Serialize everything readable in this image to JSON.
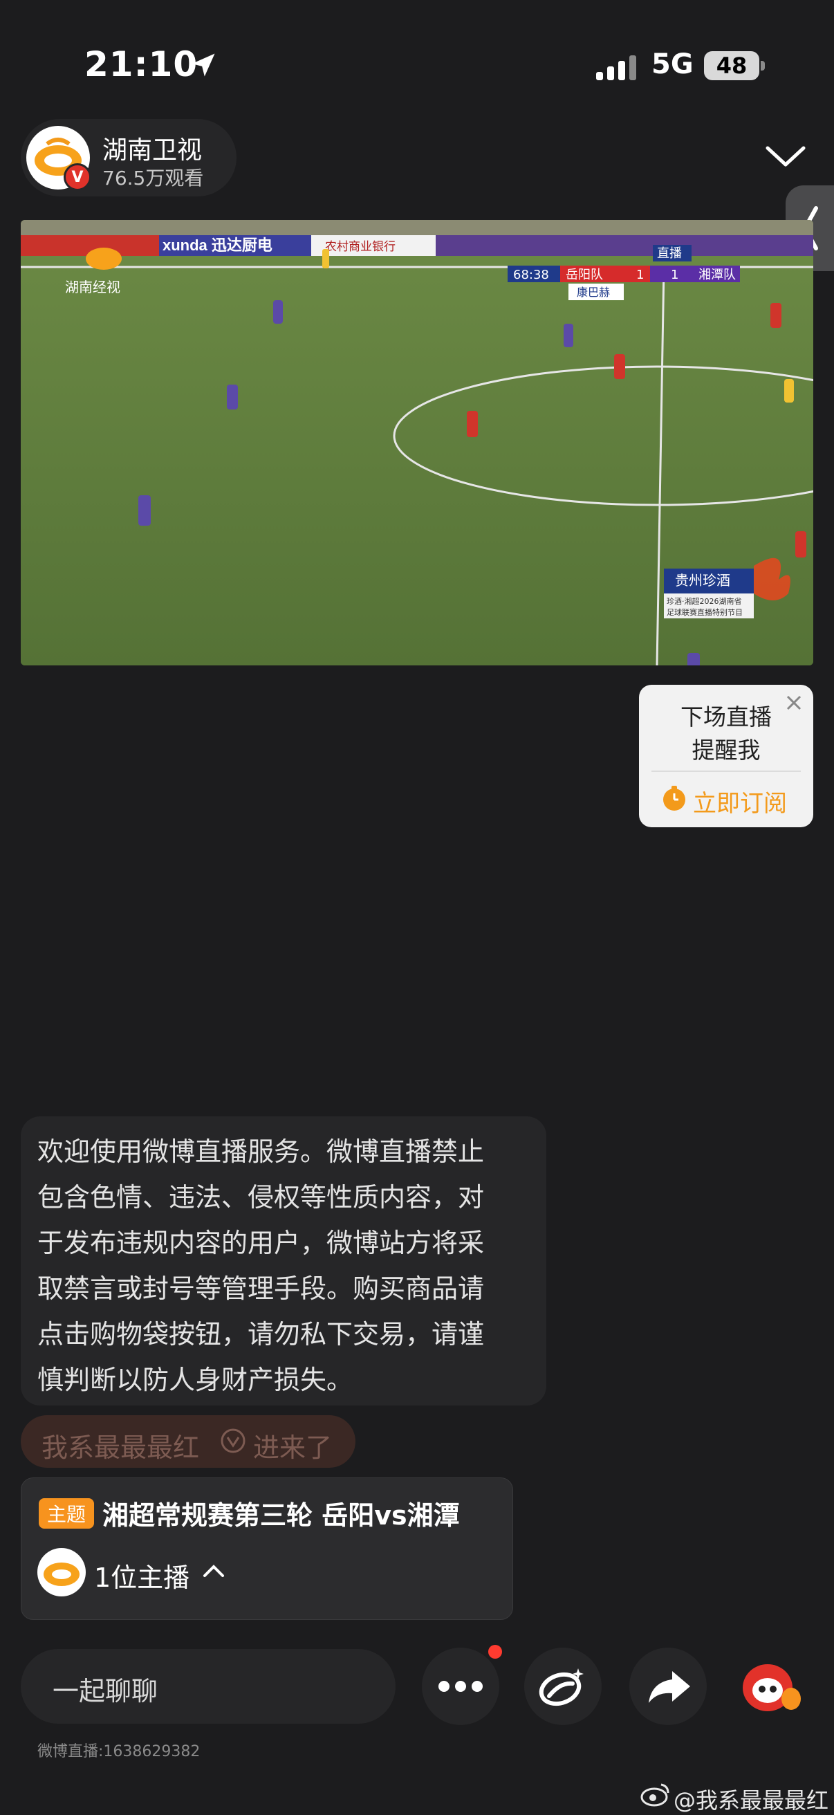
{
  "status_bar": {
    "time": "21:10",
    "network": "5G",
    "battery": "48"
  },
  "channel": {
    "name": "湖南卫视",
    "viewers": "76.5万观看",
    "verified_mark": "V"
  },
  "video": {
    "brand_logo_text": "湖南经视",
    "score_clock": "68:38",
    "home_team": "岳阳队",
    "home_score": "1",
    "away_team": "湘潭队",
    "away_score": "1",
    "live_tag": "直播",
    "sponsor_board": "xunda 迅达厨电",
    "bank_board": "农村商业银行",
    "sponsor_small": "康巴赫",
    "banner_title": "贵州珍酒",
    "banner_sub1": "珍酒·湘超2026湖南省",
    "banner_sub2": "足球联赛直播特别节目"
  },
  "reminder": {
    "line1": "下场直播",
    "line2": "提醒我",
    "action": "立即订阅"
  },
  "notice": {
    "lines": [
      "欢迎使用微博直播服务。微博直播禁止",
      "包含色情、违法、侵权等性质内容，对",
      "于发布违规内容的用户，微博站方将采",
      "取禁言或封号等管理手段。购买商品请",
      "点击购物袋按钮，请勿私下交易，请谨",
      "慎判断以防人身财产损失。"
    ]
  },
  "join": {
    "user": "我系最最最红",
    "suffix": "进来了"
  },
  "topic": {
    "tag": "主题",
    "title": "湘超常规赛第三轮 岳阳vs湘潭",
    "hosts": "1位主播"
  },
  "bottom": {
    "chat_placeholder": "一起聊聊",
    "room_id": "微博直播:1638629382"
  },
  "watermark": "@我系最最最红",
  "colors": {
    "accent_orange": "#f39a1b",
    "tag_orange": "#f7931e",
    "home_red": "#d62b2b",
    "away_purple": "#5b2ea6"
  }
}
